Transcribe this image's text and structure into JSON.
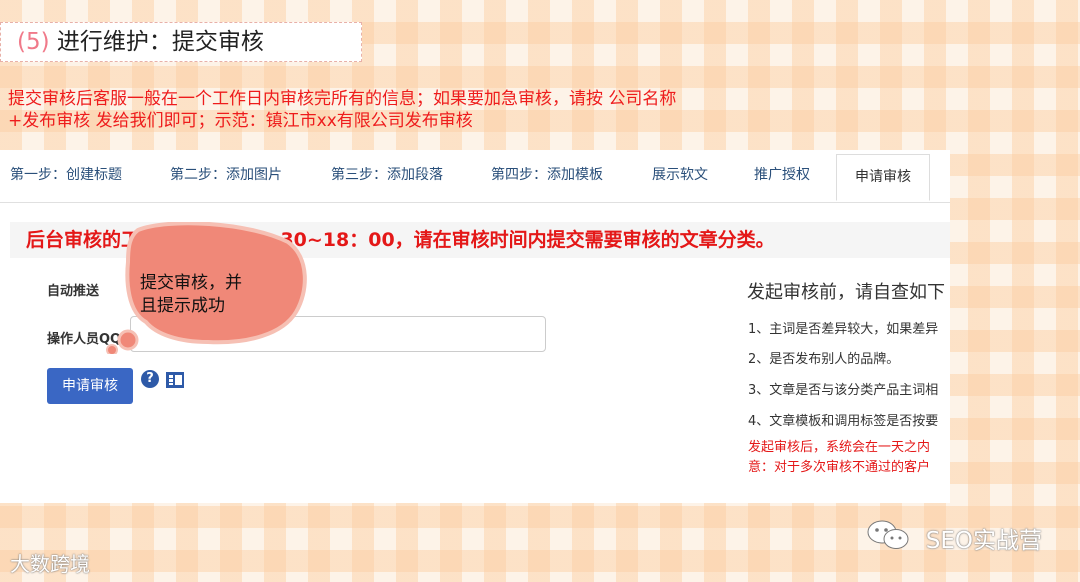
{
  "slide": {
    "title_num": "(5)",
    "title_text": "进行维护：提交审核",
    "red_line1": "提交审核后客服一般在一个工作日内审核完所有的信息；如果要加急审核，请按  公司名称",
    "red_line2": "+发布审核 发给我们即可；示范：镇江市xx有限公司发布审核"
  },
  "tabs": [
    {
      "label": "第一步：创建标题"
    },
    {
      "label": "第二步：添加图片"
    },
    {
      "label": "第三步：添加段落"
    },
    {
      "label": "第四步：添加模板"
    },
    {
      "label": "展示软文"
    },
    {
      "label": "推广授权"
    },
    {
      "label": "申请审核"
    }
  ],
  "banner": "后台审核的工作时间为：08：30~18：00，请在审核时间内提交需要审核的文章分类。",
  "form": {
    "auto_push_label": "自动推送",
    "operator_qq_label": "操作人员QQ",
    "submit_label": "申请审核",
    "help_glyph": "?"
  },
  "checklist": {
    "title": "发起审核前，请自查如下",
    "items": [
      "1、主词是否差异较大，如果差异",
      "2、是否发布别人的品牌。",
      "3、文章是否与该分类产品主词相",
      "4、文章模板和调用标签是否按要"
    ],
    "note_line1": "发起审核后，系统会在一天之内",
    "note_line2": "意：对于多次审核不通过的客户"
  },
  "callout": {
    "line1": "提交审核，并",
    "line2": "且提示成功",
    "color": "#f08878"
  },
  "watermarks": {
    "right": "SEO实战营",
    "left": "大数跨境"
  },
  "icons": [
    "help-icon",
    "video-icon",
    "wechat-icon"
  ]
}
